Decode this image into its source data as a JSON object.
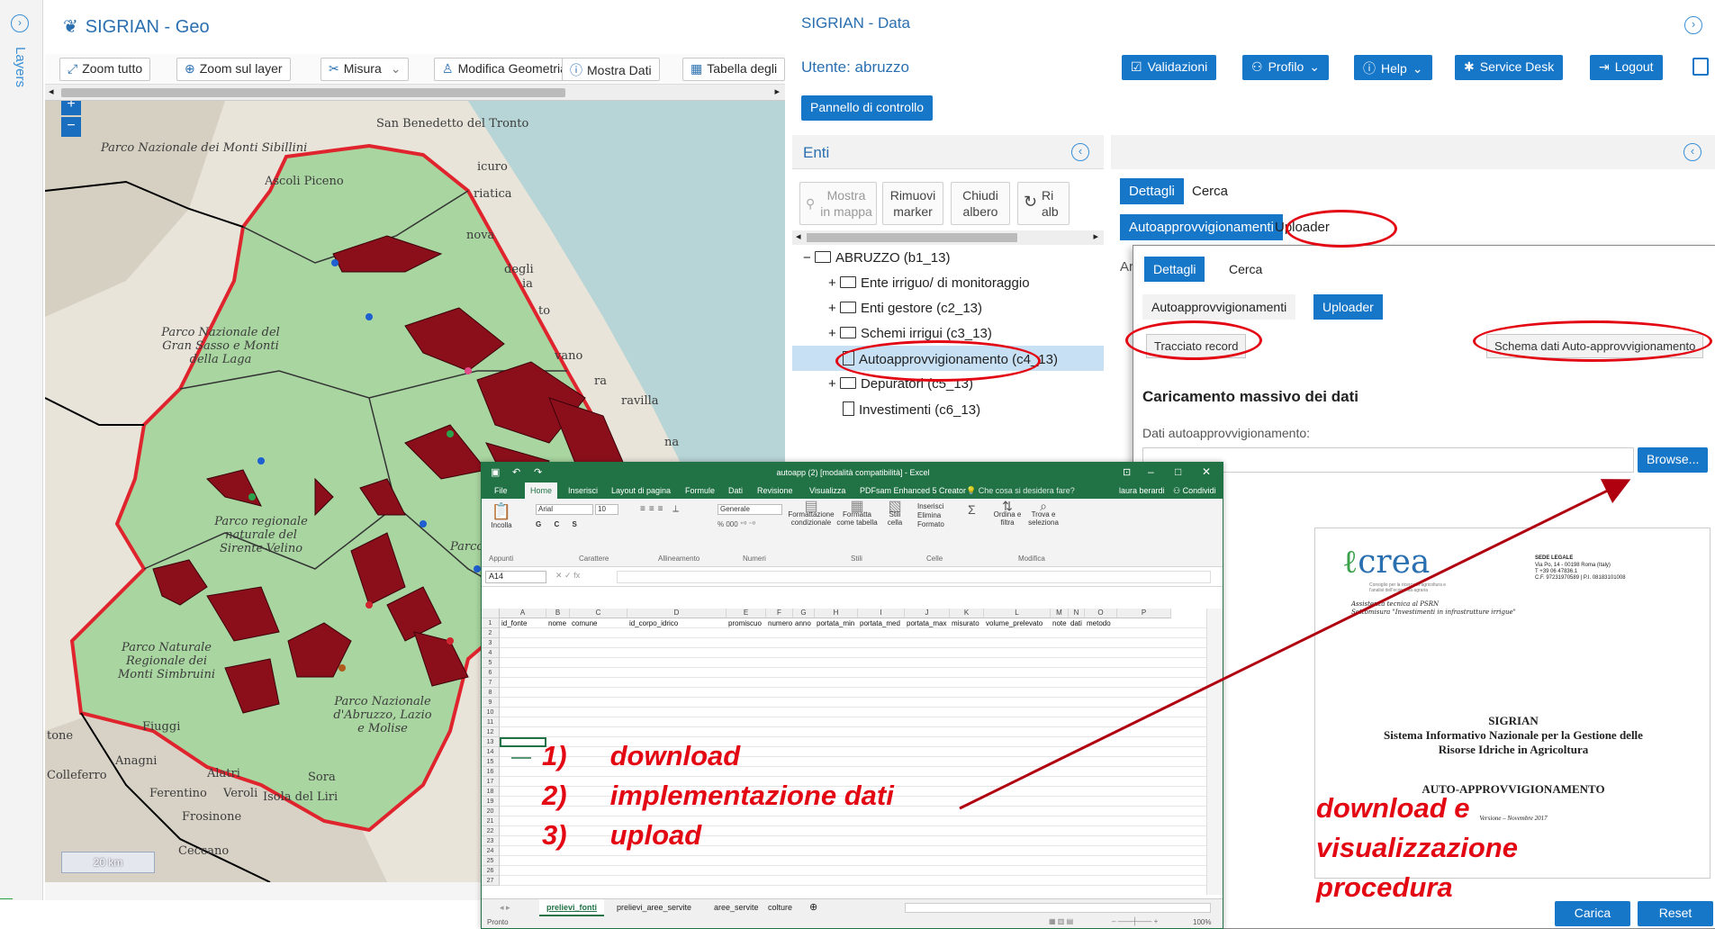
{
  "layers_panel": {
    "label": "Layers",
    "collapse_glyph": "›"
  },
  "geo": {
    "title": "SIGRIAN - Geo",
    "toolbar": [
      {
        "label": "Zoom tutto",
        "icon": "zoom-all-icon"
      },
      {
        "label": "Zoom sul layer",
        "icon": "zoom-layer-icon"
      },
      {
        "label": "Misura",
        "icon": "measure-icon"
      },
      {
        "label": "Modifica Geometria",
        "icon": "edit-geometry-icon"
      },
      {
        "label": "Mostra Dati",
        "icon": "info-icon"
      },
      {
        "label": "Tabella degli",
        "icon": "table-icon"
      }
    ],
    "zoom_in": "+",
    "zoom_out": "−",
    "scale": "20 km",
    "map_labels": [
      "Parco Nazionale dei Monti Sibillini",
      "Ascoli Piceno",
      "San Benedetto del Tronto",
      "Parco Nazionale del Gran Sasso e Monti della Laga",
      "Parco regionale naturale del Sirente-Velino",
      "Parco Naturale Regionale dei Monti Simbruini",
      "Parco Nazionale d'Abruzzo, Lazio e Molise",
      "Fiuggi",
      "Anagni",
      "Alatri",
      "Sora",
      "Colleferro",
      "Ferentino",
      "Veroli",
      "Isola del Liri",
      "Frosinone",
      "Ceccano",
      "tone",
      "vano",
      "Parco della",
      "icuro",
      "riatica",
      "nova",
      "degli",
      "ravilla",
      "ra",
      "to",
      "ia",
      "na"
    ]
  },
  "data": {
    "title": "SIGRIAN - Data",
    "user": "Utente: abruzzo",
    "header_buttons": [
      {
        "label": "Validazioni",
        "icon": "check-icon"
      },
      {
        "label": "Profilo",
        "icon": "users-icon",
        "dropdown": true
      },
      {
        "label": "Help",
        "icon": "info-icon",
        "dropdown": true
      },
      {
        "label": "Service Desk",
        "icon": "bug-icon"
      },
      {
        "label": "Logout",
        "icon": "logout-icon"
      }
    ],
    "pannello": "Pannello di controllo",
    "enti": {
      "title": "Enti",
      "buttons": [
        {
          "line1": "Mostra",
          "line2": "in mappa"
        },
        {
          "line1": "Rimuovi",
          "line2": "marker"
        },
        {
          "line1": "Chiudi",
          "line2": "albero"
        },
        {
          "line1": "Ri",
          "line2": "alb"
        }
      ],
      "tree": [
        {
          "label": "ABRUZZO (b1_13)",
          "type": "folder",
          "level": 0
        },
        {
          "label": "Ente irriguo/ di monitoraggio",
          "type": "folder",
          "level": 1
        },
        {
          "label": "Enti gestore (c2_13)",
          "type": "folder",
          "level": 1
        },
        {
          "label": "Schemi irrigui (c3_13)",
          "type": "folder",
          "level": 1
        },
        {
          "label": "Autoapprovvigionamento (c4_13)",
          "type": "doc",
          "level": 1,
          "selected": true
        },
        {
          "label": "Depuratori (c5_13)",
          "type": "folder",
          "level": 1
        },
        {
          "label": "Investimenti (c6_13)",
          "type": "doc",
          "level": 1
        }
      ]
    },
    "detail": {
      "tabs": [
        "Dettagli",
        "Cerca"
      ],
      "subtabs": [
        "Autoapprovvigionamenti",
        "Uploader"
      ],
      "cut_label": "Ar"
    }
  },
  "popup": {
    "tabs": [
      "Dettagli",
      "Cerca"
    ],
    "subtabs": [
      "Autoapprovvigionamenti",
      "Uploader"
    ],
    "tracciato": "Tracciato record",
    "schema": "Schema dati Auto-approvvigionamento",
    "section_title": "Caricamento massivo dei dati",
    "field_label": "Dati autoapprovvigionamento:",
    "browse": "Browse...",
    "carica": "Carica",
    "reset": "Reset"
  },
  "excel": {
    "title": "autoapp (2) [modalità compatibilità] - Excel",
    "user": "laura berardi",
    "share": "Condividi",
    "tell_me": "Che cosa si desidera fare?",
    "tabs": [
      "File",
      "Home",
      "Inserisci",
      "Layout di pagina",
      "Formule",
      "Dati",
      "Revisione",
      "Visualizza",
      "PDFsam Enhanced 5 Creator"
    ],
    "font": "Arial",
    "font_size": "10",
    "number_format": "Generale",
    "ribbon_groups": [
      "Appunti",
      "Carattere",
      "Allineamento",
      "Numeri",
      "Stili",
      "Celle",
      "Modifica"
    ],
    "ribbon_items": [
      "Incolla",
      "Formattazione condizionale",
      "Formatta come tabella",
      "Stili cella",
      "Inserisci",
      "Elimina",
      "Formato",
      "Ordina e filtra",
      "Trova e seleziona"
    ],
    "name_box": "A14",
    "columns": [
      "A",
      "B",
      "C",
      "D",
      "E",
      "F",
      "G",
      "H",
      "I",
      "J",
      "K",
      "L",
      "M",
      "N",
      "O",
      "P"
    ],
    "headers": [
      "id_fonte",
      "nome",
      "comune",
      "id_corpo_idrico",
      "promiscuo",
      "numero",
      "anno",
      "portata_min",
      "portata_med",
      "portata_max",
      "misurato",
      "volume_prelevato",
      "note",
      "dati",
      "metodo",
      ""
    ],
    "rows": 27,
    "sheets": [
      "prelievi_fonti",
      "prelievi_aree_servite",
      "aree_servite",
      "colture"
    ],
    "active_sheet": "prelievi_fonti",
    "status": "Pronto",
    "zoom": "100%"
  },
  "document": {
    "logo": "crea",
    "logo_sub": "Consiglio per la ricerca in agricoltura e l'analisi dell'economia agraria",
    "address_title": "SEDE LEGALE",
    "address": [
      "Via Po, 14 - 00198 Roma (Italy)",
      "T +39 06 47836.1",
      "C.F. 97231970589 | P.I. 08183101008"
    ],
    "assist": [
      "Assistenza tecnica al PSRN",
      "Sottomisura \"Investimenti in infrastrutture irrigue\""
    ],
    "heading": "SIGRIAN",
    "subheading": [
      "Sistema Informativo Nazionale per la Gestione delle",
      "Risorse Idriche in Agricoltura"
    ],
    "doc_title": "AUTO-APPROVVIGIONAMENTO",
    "version": "Versione – Novembre 2017"
  },
  "annotations": {
    "steps": [
      {
        "num": "1)",
        "text": "download"
      },
      {
        "num": "2)",
        "text": "implementazione dati"
      },
      {
        "num": "3)",
        "text": "upload"
      }
    ],
    "right_note": [
      "download e",
      "visualizzazione",
      "procedura"
    ],
    "color": "#e30613"
  },
  "colors": {
    "accent": "#1676c8",
    "link": "#2a6fb0",
    "excel": "#217346",
    "region_fill": "#a8d5a0",
    "basin": "#8b0f1b"
  }
}
